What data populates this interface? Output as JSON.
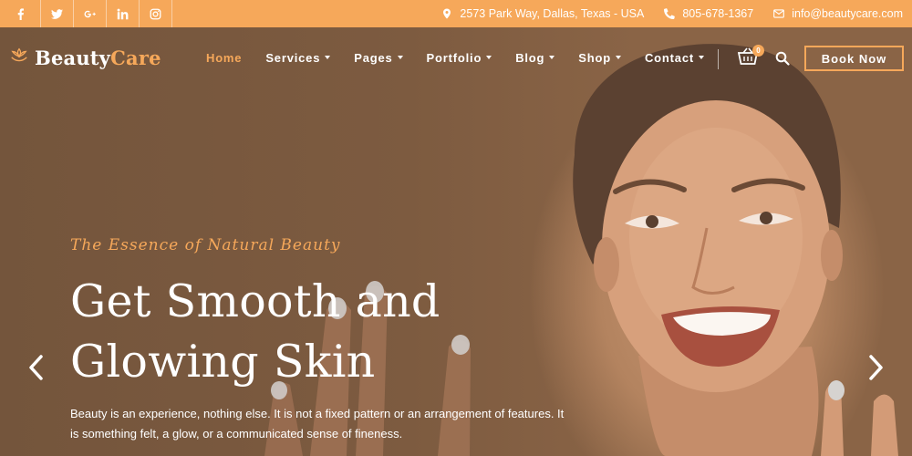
{
  "topbar": {
    "social": [
      {
        "name": "facebook-icon",
        "glyph": "f"
      },
      {
        "name": "twitter-icon",
        "glyph": "t"
      },
      {
        "name": "google-plus-icon",
        "glyph": "G+"
      },
      {
        "name": "linkedin-icon",
        "glyph": "in"
      },
      {
        "name": "instagram-icon",
        "glyph": "ig"
      }
    ],
    "address": "2573 Park Way, Dallas, Texas - USA",
    "phone": "805-678-1367",
    "email": "info@beautycare.com"
  },
  "logo": {
    "part1": "Beauty",
    "part2": "Care"
  },
  "nav": {
    "items": [
      {
        "label": "Home",
        "active": true,
        "dropdown": false
      },
      {
        "label": "Services",
        "active": false,
        "dropdown": true
      },
      {
        "label": "Pages",
        "active": false,
        "dropdown": true
      },
      {
        "label": "Portfolio",
        "active": false,
        "dropdown": true
      },
      {
        "label": "Blog",
        "active": false,
        "dropdown": true
      },
      {
        "label": "Shop",
        "active": false,
        "dropdown": true
      },
      {
        "label": "Contact",
        "active": false,
        "dropdown": true
      }
    ],
    "cart_count": "0",
    "cta": "Book Now"
  },
  "hero": {
    "eyebrow": "The Essence of Natural Beauty",
    "headline_line1": "Get Smooth and",
    "headline_line2": "Glowing Skin",
    "description": "Beauty is an experience, nothing else. It is not a fixed pattern or an arrangement of features. It is something felt, a glow, or a communicated sense of fineness."
  },
  "colors": {
    "accent": "#f6a85a",
    "topbar": "#f6a85a",
    "hero_bg": "#7a5a3f",
    "text": "#ffffff"
  }
}
